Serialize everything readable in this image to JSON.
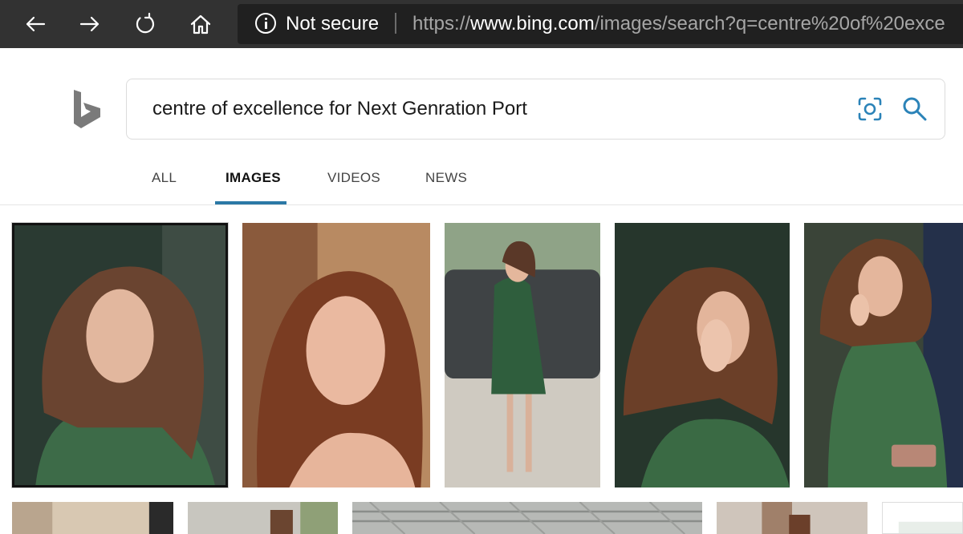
{
  "browser": {
    "security_label": "Not secure",
    "url_scheme": "https://",
    "url_host": "www.bing.com",
    "url_path": "/images/search?q=centre%20of%20exce"
  },
  "search": {
    "query": "centre of excellence for Next Genration Port"
  },
  "tabs": [
    {
      "label": "ALL",
      "active": false
    },
    {
      "label": "IMAGES",
      "active": true
    },
    {
      "label": "VIDEOS",
      "active": false
    },
    {
      "label": "NEWS",
      "active": false
    }
  ],
  "colors": {
    "chrome_bg": "#323232",
    "accent_underline": "#2b78a6",
    "search_icons": "#2b83b8",
    "bing_logo": "#7a7a7a"
  }
}
